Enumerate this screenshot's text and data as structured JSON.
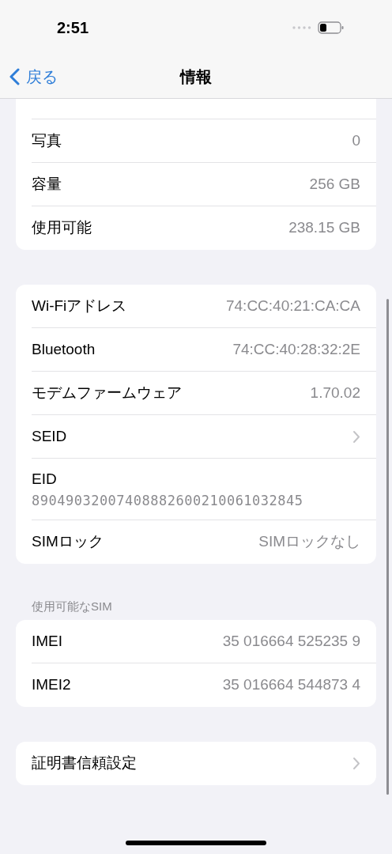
{
  "status_bar": {
    "time": "2:51"
  },
  "nav": {
    "back": "戻る",
    "title": "情報"
  },
  "groups": [
    {
      "cut_top": true,
      "rows": [
        {
          "kind": "value",
          "label": "写真",
          "value": "0"
        },
        {
          "kind": "value",
          "label": "容量",
          "value": "256 GB"
        },
        {
          "kind": "value",
          "label": "使用可能",
          "value": "238.15 GB"
        }
      ]
    },
    {
      "rows": [
        {
          "kind": "value",
          "label": "Wi-Fiアドレス",
          "value": "74:CC:40:21:CA:CA"
        },
        {
          "kind": "value",
          "label": "Bluetooth",
          "value": "74:CC:40:28:32:2E"
        },
        {
          "kind": "value",
          "label": "モデムファームウェア",
          "value": "1.70.02"
        },
        {
          "kind": "chevron",
          "label": "SEID"
        },
        {
          "kind": "stacked",
          "label": "EID",
          "value": "89049032007408882600210061032845"
        },
        {
          "kind": "value",
          "label": "SIMロック",
          "value": "SIMロックなし"
        }
      ]
    },
    {
      "header": "使用可能なSIM",
      "rows": [
        {
          "kind": "value",
          "label": "IMEI",
          "value": "35 016664 525235 9"
        },
        {
          "kind": "value",
          "label": "IMEI2",
          "value": "35 016664 544873 4"
        }
      ]
    },
    {
      "rows": [
        {
          "kind": "chevron",
          "label": "証明書信頼設定"
        }
      ]
    }
  ]
}
